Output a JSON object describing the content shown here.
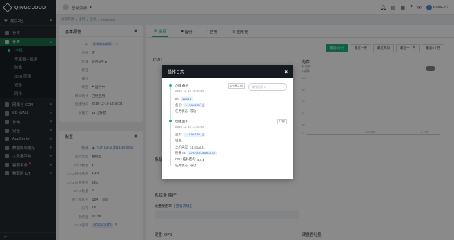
{
  "brand": {
    "name": "QINGCLOUD"
  },
  "zone": {
    "label": "北京3区"
  },
  "sidebar": {
    "items": [
      {
        "label": "总览"
      },
      {
        "label": "计算"
      },
      {
        "label": "主机"
      },
      {
        "label": "专属宿主机组"
      },
      {
        "label": "映像"
      },
      {
        "label": "SSH 密钥"
      },
      {
        "label": "设备"
      },
      {
        "label": "网卡"
      },
      {
        "label": "网络与 CDN"
      },
      {
        "label": "SD-WAN"
      },
      {
        "label": "存储"
      },
      {
        "label": "安全"
      },
      {
        "label": "AppCenter"
      },
      {
        "label": "数据库与缓存"
      },
      {
        "label": "大数据平台"
      },
      {
        "label": "容器平台"
      },
      {
        "label": "物联网 IoT"
      }
    ],
    "bottom": "⇤"
  },
  "topbar": {
    "project": "全部资源",
    "user": "60904287"
  },
  "breadcrumb": [
    "全部资源",
    "主机",
    "主机",
    "i-sak52mlj"
  ],
  "basic": {
    "title": "基本属性",
    "rows": [
      {
        "k": "ID",
        "v": "i-sak52mlj"
      },
      {
        "k": "名称",
        "v": "无"
      },
      {
        "k": "区域",
        "v": "北京3区-D"
      },
      {
        "k": "标签",
        "v": ""
      },
      {
        "k": "描述",
        "v": ""
      },
      {
        "k": "状态",
        "v": "运行中"
      },
      {
        "k": "时间统计",
        "v": "已经启用"
      },
      {
        "k": "创建时间",
        "v": "2019-12-19 14:50:04"
      },
      {
        "k": "创建于",
        "v": "11 分钟前"
      }
    ]
  },
  "config": {
    "title": "配置",
    "rows": [
      {
        "k": "映像",
        "v": "Arch Linux 2013.10 64bit"
      },
      {
        "k": "主机类型",
        "v": "基础型"
      },
      {
        "k": "CPU 数量",
        "v": "1"
      },
      {
        "k": "CPU 拓扑结构",
        "v": "1,1,1"
      },
      {
        "k": "CPU 体系架构",
        "v": "默认"
      },
      {
        "k": "GPU 数量",
        "v": "0"
      },
      {
        "k": "网卡多队列",
        "v": "禁用"
      },
      {
        "k": "内存",
        "v": "1G"
      },
      {
        "k": "系统盘",
        "v": "20 GB"
      },
      {
        "k": "SSH 密钥",
        "v": "[rocktalf]"
      }
    ]
  },
  "tabs": [
    {
      "label": "监控",
      "icon": "chart-icon"
    },
    {
      "label": "备份",
      "icon": "camera-icon"
    },
    {
      "label": "告警",
      "icon": "bell-icon"
    },
    {
      "label": "图形化",
      "icon": "image-icon"
    }
  ],
  "time_buttons": [
    "最近6小时",
    "最近一天",
    "最近两周",
    "最近一个月",
    "最近6个月"
  ],
  "charts": {
    "cpu": "CPU",
    "memory": "内存",
    "memory_legend": "内存",
    "memory_sub": "5分钟",
    "memory_y": [
      "100",
      "80",
      "60",
      "40",
      "20",
      "0"
    ],
    "memory_x": [
      "12 PM",
      "3 PM"
    ]
  },
  "lower": {
    "system": "系统",
    "system_disk": "系统盘 监控",
    "disk_usage": "硬盘使用率",
    "disk_usage_link": "[ 查看高级 ]",
    "disk_iops": "硬盘 IOPS",
    "disk_throughput": "硬盘吞吐量"
  },
  "modal": {
    "title": "操作日志",
    "search_placeholder": "操作资源 ID",
    "entries": [
      {
        "title": "创建备份",
        "time": "2019-12-19 15:08:45",
        "badge": "1分钟之前",
        "rows": [
          {
            "k": "ID:",
            "v": "12345"
          },
          {
            "k": "备份:",
            "v": "i-sak52mlj"
          },
          {
            "k": "任务状态:",
            "v": "成功"
          }
        ]
      },
      {
        "title": "创建主机",
        "time": "2019-12-19 14:50:00",
        "badge": "17秒",
        "rows": [
          {
            "k": "主机:",
            "v": "i-sak52mlj"
          },
          {
            "k": "镜像:",
            "v": ""
          },
          {
            "k": "主机类型:",
            "v": "c1.small.t1"
          },
          {
            "k": "映像 ID:",
            "v": "arch201310x64a"
          },
          {
            "k": "CPU 拓扑结构:",
            "v": "1,1,1"
          },
          {
            "k": "任务状态:",
            "v": "成功"
          }
        ]
      }
    ]
  }
}
